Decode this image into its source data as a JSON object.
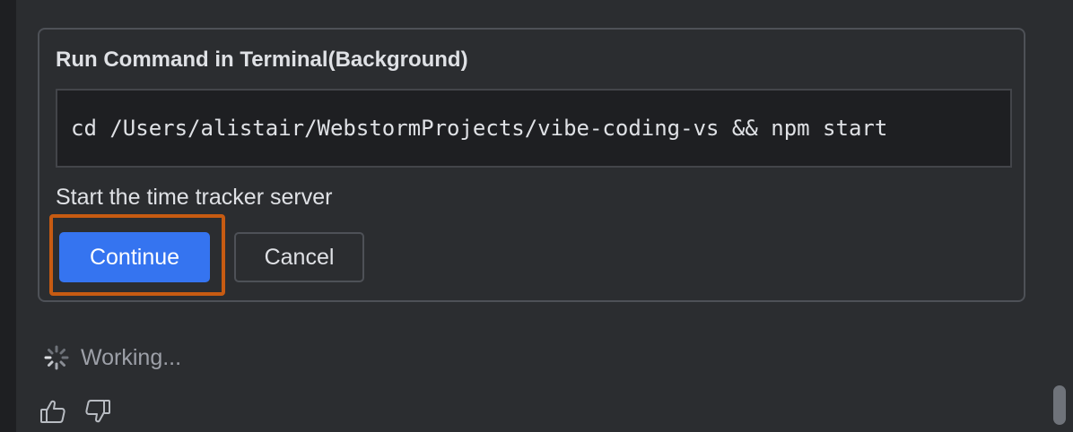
{
  "card": {
    "title": "Run Command in Terminal(Background)",
    "command": "cd /Users/alistair/WebstormProjects/vibe-coding-vs && npm start",
    "description": "Start the time tracker server",
    "continue_label": "Continue",
    "cancel_label": "Cancel"
  },
  "status": {
    "icon": "spinner-icon",
    "text": "Working..."
  },
  "feedback": {
    "like_icon": "thumbs-up-icon",
    "dislike_icon": "thumbs-down-icon"
  },
  "colors": {
    "primary": "#3574f0",
    "highlight": "#c75b12",
    "background": "#2b2d30"
  }
}
